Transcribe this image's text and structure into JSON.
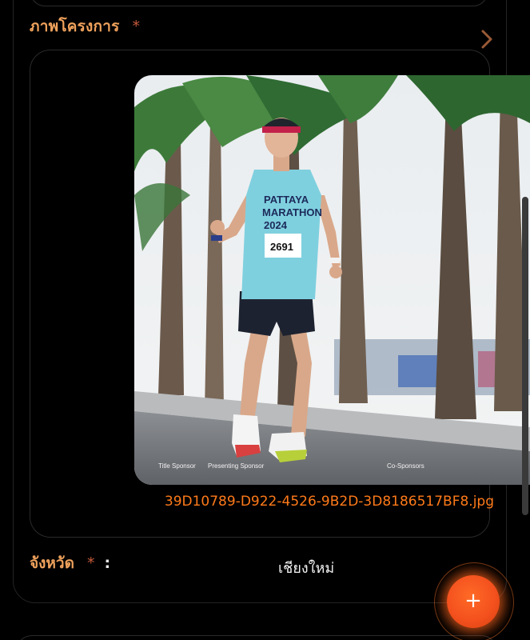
{
  "project_image": {
    "label": "ภาพโครงการ",
    "required_mark": "*",
    "file_name": "39D10789-D922-4526-9B2D-3D8186517BF8.jpg",
    "photo": {
      "bib_number": "2691",
      "shirt_text_1": "PATTAYA",
      "shirt_text_2": "MARATHON",
      "shirt_text_3": "2024",
      "banner_text_1": "Title Sponsor",
      "banner_text_2": "Presenting Sponsor",
      "banner_text_3": "Co-Sponsors"
    }
  },
  "province": {
    "label": "จังหวัด",
    "required_mark": "*",
    "colon": ":",
    "value": "เชียงใหม่"
  },
  "fab": {
    "label": "+"
  },
  "icons": {
    "chevron": "chevron-right-icon",
    "fab": "plus-icon"
  },
  "colors": {
    "accent": "#f0a25c",
    "file_link": "#ff7a1a",
    "fab": "#f4511e",
    "required": "#c65a3a"
  }
}
